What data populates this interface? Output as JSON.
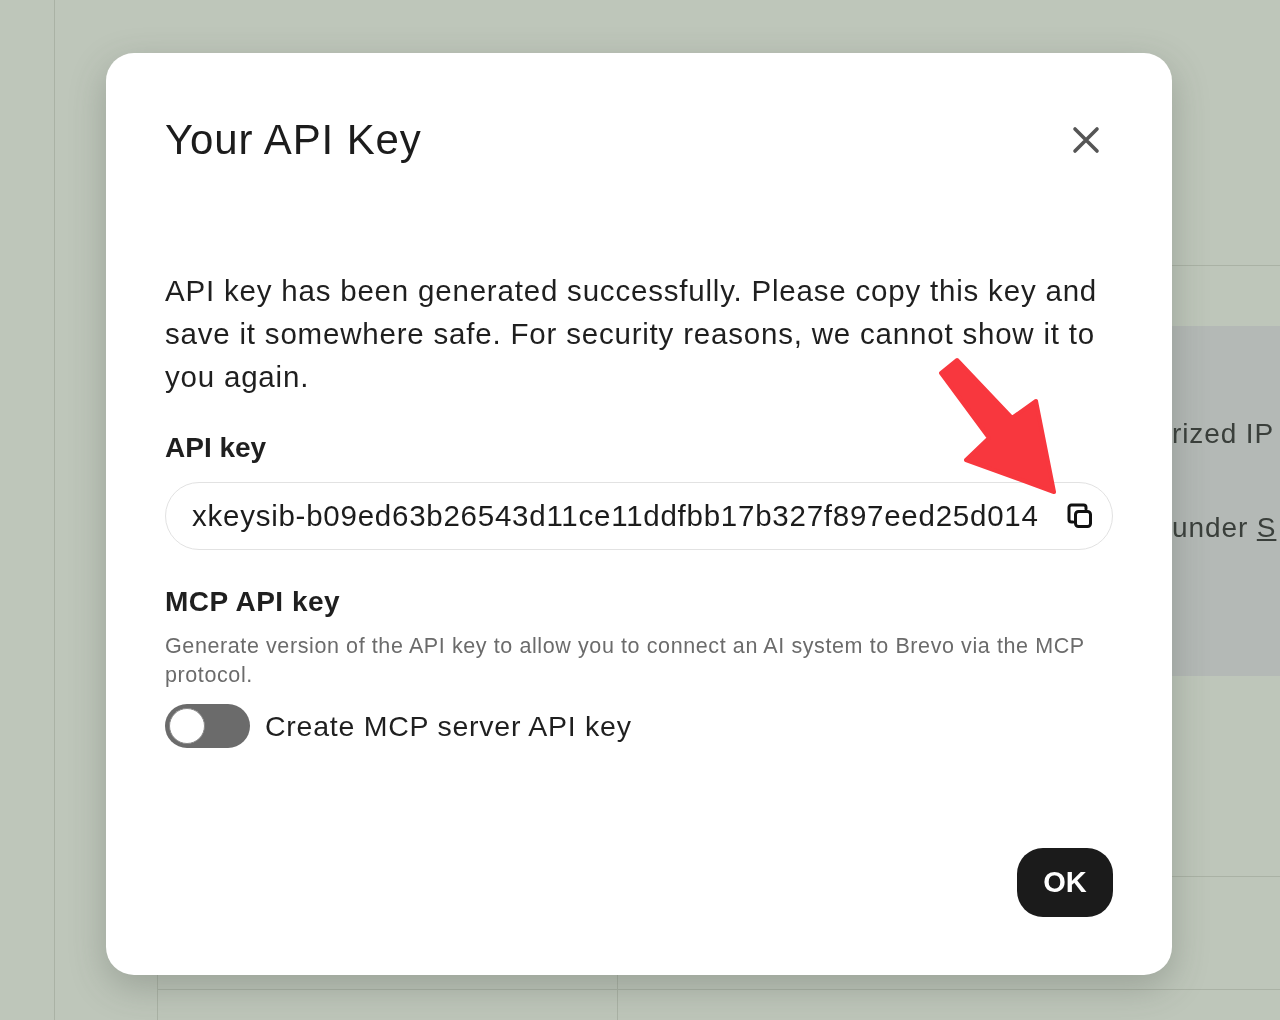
{
  "background": {
    "panel": {
      "line_1": "rized IP",
      "line_2": {
        "text": "under",
        "link": "S"
      }
    }
  },
  "dialog": {
    "title": "Your API Key",
    "message": "API key has been generated successfully. Please copy this key and save it somewhere safe. For security reasons, we cannot show it to you again.",
    "api_key": {
      "label": "API key",
      "value": "xkeysib-b09ed63b26543d11ce11ddfbb17b327f897eed25d014"
    },
    "mcp": {
      "heading": "MCP API key",
      "description": "Generate version of the API key to allow you to connect an AI system to Brevo via the MCP protocol.",
      "toggle": {
        "label": "Create MCP server API key",
        "on": false
      }
    },
    "ok_button": "OK"
  }
}
